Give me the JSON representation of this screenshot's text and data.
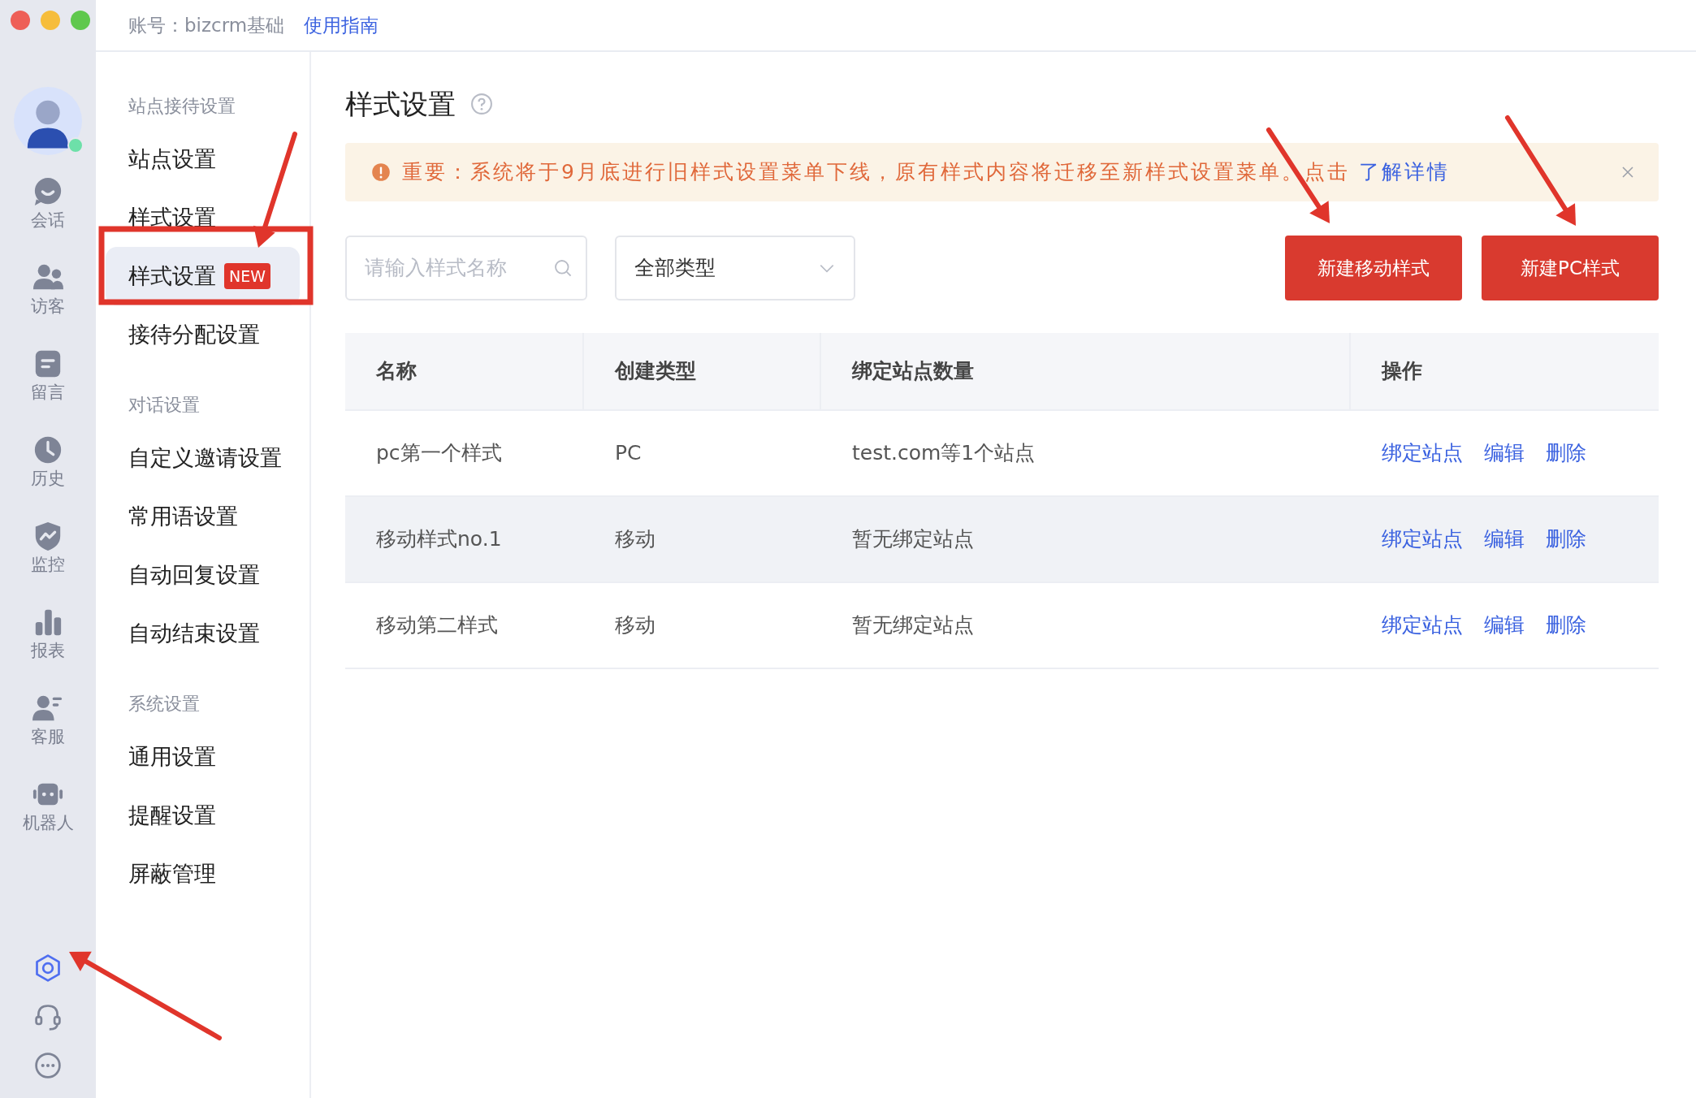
{
  "top_bar": {
    "account": "账号：bizcrm基础",
    "guide_link": "使用指南"
  },
  "rail": {
    "avatar": {
      "online": true
    },
    "items": [
      {
        "label": "会话"
      },
      {
        "label": "访客"
      },
      {
        "label": "留言"
      },
      {
        "label": "历史"
      },
      {
        "label": "监控"
      },
      {
        "label": "报表"
      },
      {
        "label": "客服"
      },
      {
        "label": "机器人"
      }
    ],
    "bottom_icons": [
      {
        "selected": true
      },
      {
        "selected": false
      },
      {
        "selected": false
      }
    ]
  },
  "menu": [
    {
      "heading": "站点接待设置",
      "items": [
        {
          "label": "站点设置",
          "selected": false
        },
        {
          "label": "样式设置",
          "selected": false
        },
        {
          "label": "样式设置",
          "selected": true,
          "badge": "NEW"
        },
        {
          "label": "接待分配设置",
          "selected": false
        }
      ]
    },
    {
      "heading": "对话设置",
      "items": [
        {
          "label": "自定义邀请设置",
          "selected": false
        },
        {
          "label": "常用语设置",
          "selected": false
        },
        {
          "label": "自动回复设置",
          "selected": false
        },
        {
          "label": "自动结束设置",
          "selected": false
        }
      ]
    },
    {
      "heading": "系统设置",
      "items": [
        {
          "label": "通用设置",
          "selected": false
        },
        {
          "label": "提醒设置",
          "selected": false
        },
        {
          "label": "屏蔽管理",
          "selected": false
        }
      ]
    }
  ],
  "page": {
    "title": "样式设置",
    "alert": {
      "text": "重要：系统将于9月底进行旧样式设置菜单下线，原有样式内容将迁移至新样式设置菜单。点击",
      "link": "了解详情"
    },
    "search": {
      "placeholder": "请输入样式名称"
    },
    "type_filter": {
      "value": "全部类型"
    },
    "buttons": [
      "新建移动样式",
      "新建PC样式"
    ],
    "table": {
      "columns": [
        "名称",
        "创建类型",
        "绑定站点数量",
        "操作"
      ],
      "rows": [
        {
          "cells": [
            "pc第一个样式",
            "PC",
            "test.com等1个站点"
          ],
          "actions": [
            "绑定站点",
            "编辑",
            "删除"
          ],
          "highlighted": false
        },
        {
          "cells": [
            "移动样式no.1",
            "移动",
            "暂无绑定站点"
          ],
          "actions": [
            "绑定站点",
            "编辑",
            "删除"
          ],
          "highlighted": true
        },
        {
          "cells": [
            "移动第二样式",
            "移动",
            "暂无绑定站点"
          ],
          "actions": [
            "绑定站点",
            "编辑",
            "删除"
          ],
          "highlighted": false
        }
      ]
    }
  }
}
